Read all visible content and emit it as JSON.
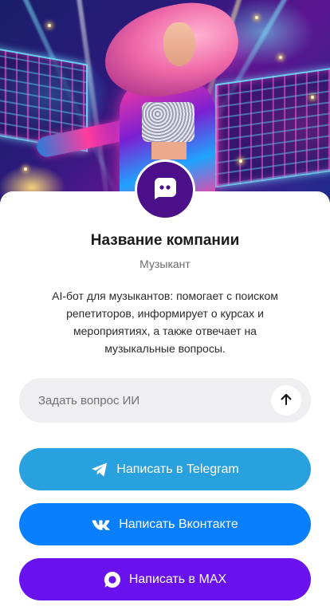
{
  "profile": {
    "company_name": "Название компании",
    "role": "Музыкант",
    "description": "AI-бот для музыкантов: помогает с поиском репетиторов, информирует о курсах и мероприятиях, а также отвечает на музыкальные вопросы.",
    "avatar_icon": "chat-bot-icon"
  },
  "ask": {
    "placeholder": "Задать вопрос ИИ",
    "send_icon": "arrow-up-icon"
  },
  "actions": [
    {
      "label": "Написать в Telegram",
      "icon": "telegram-icon",
      "color": "#2aa1df"
    },
    {
      "label": "Написать Вконтакте",
      "icon": "vk-icon",
      "color": "#0a7ffc"
    },
    {
      "label": "Написать в MAX",
      "icon": "max-icon",
      "color": "#6a12ee"
    }
  ],
  "colors": {
    "avatar_bg": "#4b0f8a",
    "input_bg": "#efeff1"
  }
}
